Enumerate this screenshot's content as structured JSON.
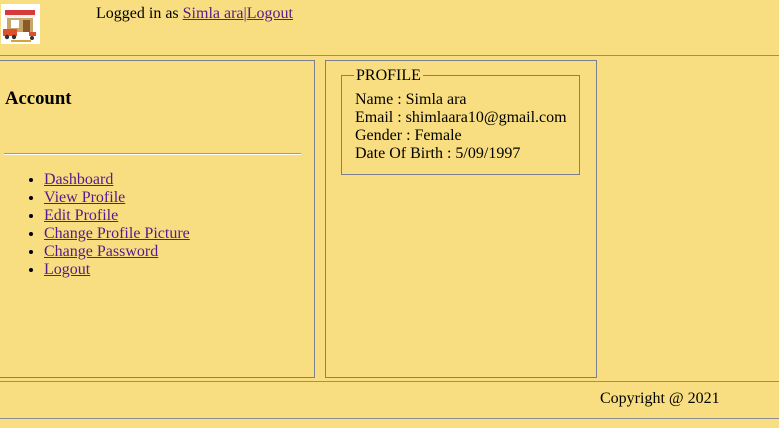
{
  "header": {
    "logo_icon": "shop-cart-logo-icon",
    "logged_in_prefix": "Logged in as ",
    "username_link": "Simla ara",
    "separator": "|",
    "logout_link": "Logout"
  },
  "sidebar": {
    "title": "Account",
    "items": [
      {
        "label": "Dashboard"
      },
      {
        "label": "View Profile"
      },
      {
        "label": "Edit Profile"
      },
      {
        "label": "Change Profile Picture"
      },
      {
        "label": "Change Password"
      },
      {
        "label": "Logout"
      }
    ]
  },
  "profile": {
    "legend": "PROFILE",
    "name_line": "Name : Simla ara",
    "email_line": "Email : shimlaara10@gmail.com",
    "gender_line": "Gender : Female",
    "dob_line": "Date Of Birth : 5/09/1997"
  },
  "footer": {
    "copyright": "Copyright @ 2021"
  },
  "colors": {
    "background": "#f8de80",
    "link": "#551a8b",
    "border": "#7a8090"
  }
}
